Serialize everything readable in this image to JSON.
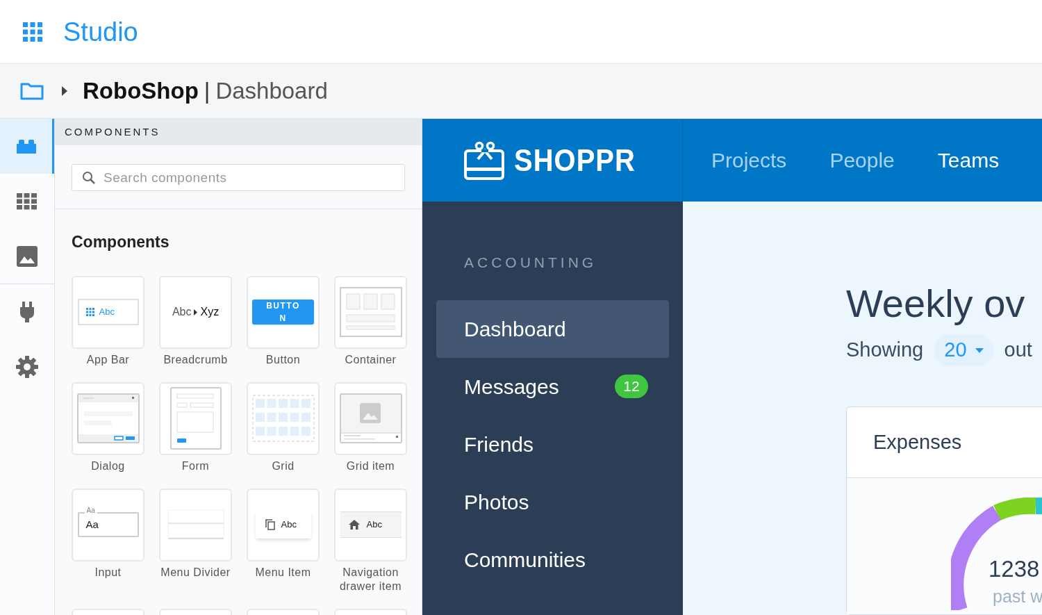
{
  "top_bar": {
    "title": "Studio"
  },
  "breadcrumb": {
    "project": "RoboShop",
    "separator": "|",
    "page": "Dashboard"
  },
  "rail": {
    "groups": [
      [
        {
          "kind": "blocks",
          "selected": true
        },
        {
          "kind": "grid",
          "selected": false
        },
        {
          "kind": "image",
          "selected": false
        }
      ],
      [
        {
          "kind": "plug",
          "selected": false
        },
        {
          "kind": "settings",
          "selected": false
        }
      ]
    ]
  },
  "panel": {
    "header": "COMPONENTS",
    "search": {
      "placeholder": "Search components"
    },
    "section_title": "Components",
    "tiles": [
      {
        "kind": "app_bar",
        "label": "App Bar",
        "texts": [
          "Abc"
        ]
      },
      {
        "kind": "breadcrumb",
        "label": "Breadcrumb",
        "texts": [
          "Abc",
          "Xyz"
        ]
      },
      {
        "kind": "button",
        "label": "Button",
        "texts": [
          "BUTTON"
        ]
      },
      {
        "kind": "container",
        "label": "Container"
      },
      {
        "kind": "dialog",
        "label": "Dialog"
      },
      {
        "kind": "form",
        "label": "Form"
      },
      {
        "kind": "grid",
        "label": "Grid"
      },
      {
        "kind": "grid_item",
        "label": "Grid item"
      },
      {
        "kind": "input",
        "label": "Input",
        "texts": [
          "Aa",
          "Aa"
        ]
      },
      {
        "kind": "menu_divider",
        "label": "Menu Divider"
      },
      {
        "kind": "menu_item",
        "label": "Menu Item",
        "texts": [
          "Abc"
        ]
      },
      {
        "kind": "nav_item",
        "label": "Navigation drawer item",
        "texts": [
          "Abc"
        ]
      },
      {
        "kind": "blank"
      },
      {
        "kind": "blank"
      },
      {
        "kind": "blank"
      },
      {
        "kind": "blank"
      }
    ]
  },
  "preview": {
    "logo": "SHOPPR",
    "nav": [
      {
        "label": "Projects",
        "selected": false
      },
      {
        "label": "People",
        "selected": false
      },
      {
        "label": "Teams",
        "selected": true
      }
    ],
    "sidebar": {
      "section": "ACCOUNTING",
      "items": [
        {
          "label": "Dashboard",
          "selected": true
        },
        {
          "label": "Messages",
          "selected": false,
          "badge": "12"
        },
        {
          "label": "Friends",
          "selected": false
        },
        {
          "label": "Photos",
          "selected": false
        },
        {
          "label": "Communities",
          "selected": false
        }
      ]
    },
    "content": {
      "title": "Weekly ov",
      "showing": "Showing",
      "count": "20",
      "after": "out",
      "card": {
        "title": "Expenses",
        "total": "1238",
        "caption": "past w"
      }
    }
  }
}
